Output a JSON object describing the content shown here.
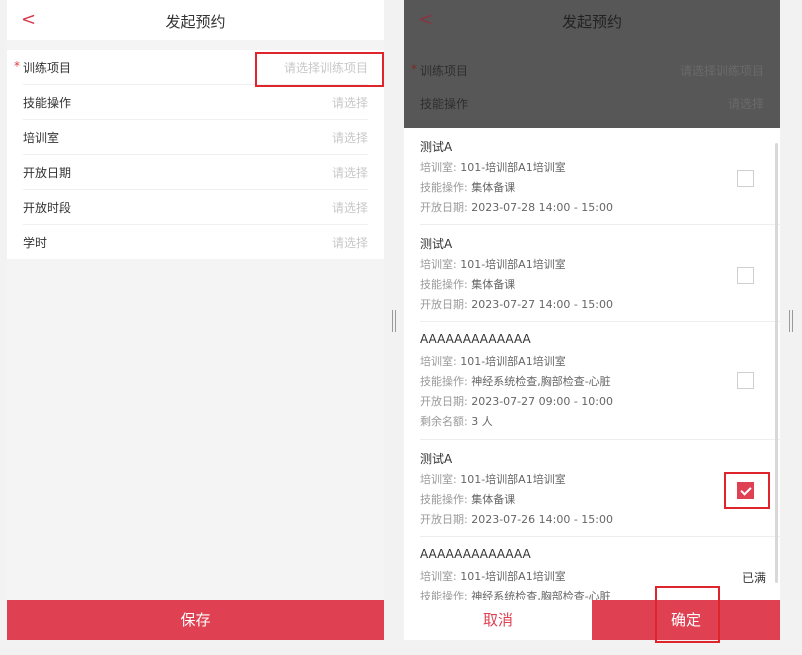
{
  "left": {
    "back_glyph": "<",
    "title": "发起预约",
    "fields": [
      {
        "label": "训练项目",
        "placeholder": "请选择训练项目",
        "required": true
      },
      {
        "label": "技能操作",
        "placeholder": "请选择",
        "required": false
      },
      {
        "label": "培训室",
        "placeholder": "请选择",
        "required": false
      },
      {
        "label": "开放日期",
        "placeholder": "请选择",
        "required": false
      },
      {
        "label": "开放时段",
        "placeholder": "请选择",
        "required": false
      },
      {
        "label": "学时",
        "placeholder": "请选择",
        "required": false
      }
    ],
    "save_label": "保存"
  },
  "right": {
    "back_glyph": "<",
    "title": "发起预约",
    "dim_fields": [
      {
        "label": "训练项目",
        "placeholder": "请选择训练项目"
      },
      {
        "label": "技能操作",
        "placeholder": "请选择"
      }
    ],
    "items": [
      {
        "name": "测试A",
        "room_label": "培训室:",
        "room": "101-培训部A1培训室",
        "skill_label": "技能操作:",
        "skill": "集体备课",
        "date_label": "开放日期:",
        "date": "2023-07-28 14:00 - 15:00",
        "checked": false
      },
      {
        "name": "测试A",
        "room_label": "培训室:",
        "room": "101-培训部A1培训室",
        "skill_label": "技能操作:",
        "skill": "集体备课",
        "date_label": "开放日期:",
        "date": "2023-07-27 14:00 - 15:00",
        "checked": false
      },
      {
        "name": "AAAAAAAAAAAAA",
        "room_label": "培训室:",
        "room": "101-培训部A1培训室",
        "skill_label": "技能操作:",
        "skill": "神经系统检查,胸部检查-心脏",
        "date_label": "开放日期:",
        "date": "2023-07-27 09:00 - 10:00",
        "remain_label": "剩余名额:",
        "remain": "3 人",
        "checked": false
      },
      {
        "name": "测试A",
        "room_label": "培训室:",
        "room": "101-培训部A1培训室",
        "skill_label": "技能操作:",
        "skill": "集体备课",
        "date_label": "开放日期:",
        "date": "2023-07-26 14:00 - 15:00",
        "checked": true
      },
      {
        "name": "AAAAAAAAAAAAA",
        "room_label": "培训室:",
        "room": "101-培训部A1培训室",
        "skill_label": "技能操作:",
        "skill": "神经系统检查,胸部检查-心脏",
        "status": "已满",
        "checked": false
      }
    ],
    "cancel_label": "取消",
    "confirm_label": "确定"
  },
  "colors": {
    "accent": "#df4153",
    "highlight_box": "#e0242c"
  }
}
